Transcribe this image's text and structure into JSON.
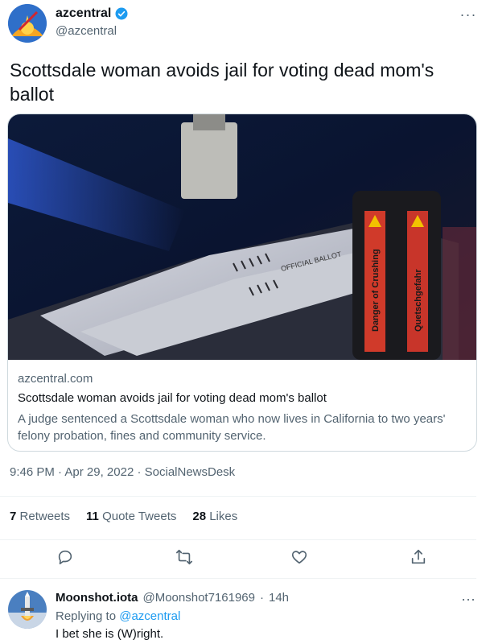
{
  "tweet": {
    "author_name": "azcentral",
    "author_handle": "@azcentral",
    "text": "Scottsdale woman avoids jail for voting dead mom's ballot",
    "more": "···",
    "verified_color": "#1d9bf0"
  },
  "card": {
    "domain": "azcentral.com",
    "title": "Scottsdale woman avoids jail for voting dead mom's ballot",
    "description": "A judge sentenced a Scottsdale woman who now lives in California to two years' felony probation, fines and community service.",
    "image_texts": {
      "official_ballot": "OFFICIAL BALLOT",
      "warning_left": "Danger of Crushing",
      "warning_right": "Quetschgefahr"
    }
  },
  "meta": {
    "time": "9:46 PM",
    "sep1": "·",
    "date": "Apr 29, 2022",
    "sep2": "·",
    "source": "SocialNewsDesk"
  },
  "stats": {
    "retweets_count": "7",
    "retweets_label": "Retweets",
    "quotes_count": "11",
    "quotes_label": "Quote Tweets",
    "likes_count": "28",
    "likes_label": "Likes"
  },
  "actions": [
    "reply-icon",
    "retweet-icon",
    "like-icon",
    "share-icon"
  ],
  "reply": {
    "name": "Moonshot.iota",
    "handle": "@Moonshot7161969",
    "sep": "·",
    "time": "14h",
    "replying_prefix": "Replying to",
    "replying_to": "@azcentral",
    "text": "I bet she is (W)right.",
    "more": "···"
  }
}
